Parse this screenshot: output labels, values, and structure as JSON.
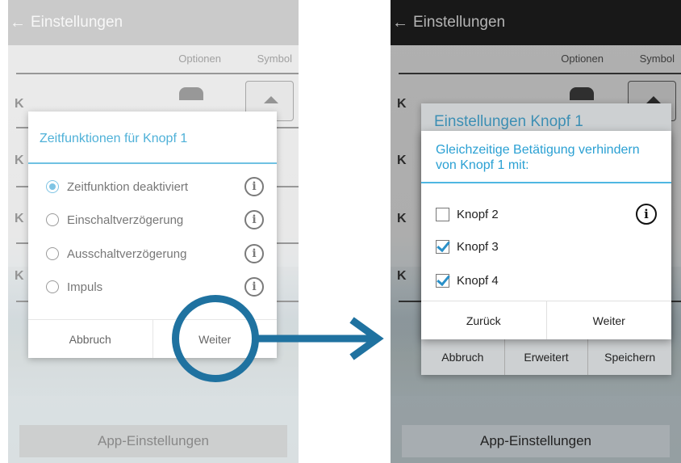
{
  "left_screen": {
    "appbar": {
      "back_icon": "arrow-left-icon",
      "title": "Einstellungen"
    },
    "header": {
      "options": "Optionen",
      "symbol": "Symbol"
    },
    "row_letters": [
      "K",
      "K",
      "K",
      "K"
    ],
    "dialog": {
      "title": "Zeitfunktionen für Knopf 1",
      "options": [
        {
          "label": "Zeitfunktion deaktiviert",
          "selected": true
        },
        {
          "label": "Einschaltverzögerung",
          "selected": false
        },
        {
          "label": "Ausschaltverzögerung",
          "selected": false
        },
        {
          "label": "Impuls",
          "selected": false
        }
      ],
      "cancel": "Abbruch",
      "next": "Weiter"
    },
    "app_settings": "App-Einstellungen"
  },
  "right_screen": {
    "appbar": {
      "back_icon": "arrow-left-icon",
      "title": "Einstellungen"
    },
    "header": {
      "options": "Optionen",
      "symbol": "Symbol"
    },
    "row_letters": [
      "K",
      "K",
      "K",
      "K"
    ],
    "back_dialog": {
      "title": "Einstellungen Knopf 1",
      "buttons": [
        "Abbruch",
        "Erweitert",
        "Speichern"
      ]
    },
    "dialog": {
      "title": "Gleichzeitige Betätigung verhindern von Knopf 1 mit:",
      "items": [
        {
          "label": "Knopf 2",
          "checked": false
        },
        {
          "label": "Knopf 3",
          "checked": true
        },
        {
          "label": "Knopf 4",
          "checked": true
        }
      ],
      "back": "Zurück",
      "next": "Weiter"
    },
    "app_settings": "App-Einstellungen"
  },
  "annotation": {
    "color": "#1f72a0"
  }
}
